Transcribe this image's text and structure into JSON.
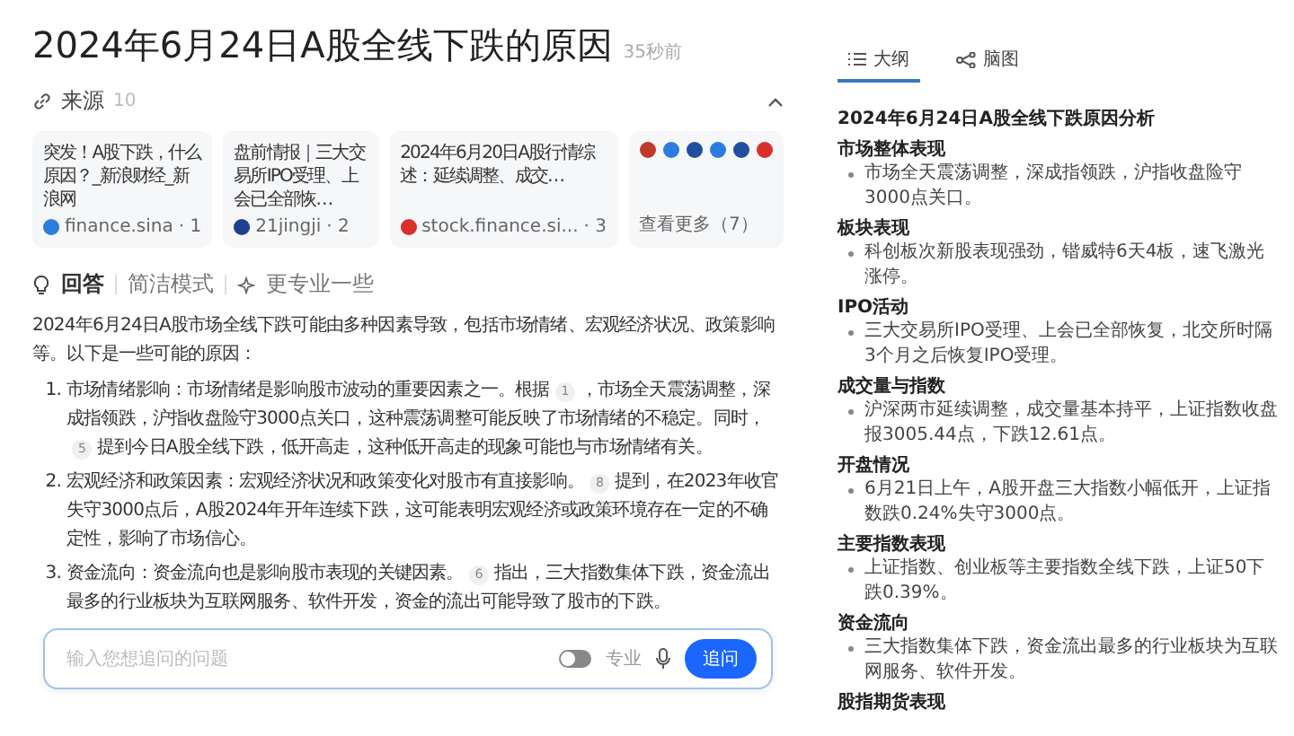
{
  "title": "2024年6月24日A股全线下跌的原因",
  "time": "35秒前",
  "sources": {
    "label": "来源",
    "count": "10",
    "expanded": true,
    "cards": [
      {
        "title": "突发！A股下跌，什么原因？_新浪财经_新浪网",
        "site": "finance.sina",
        "index": "· 1",
        "color": "#2b7de0"
      },
      {
        "title": "盘前情报｜三大交易所IPO受理、上会已全部恢…",
        "site": "21jingji",
        "index": "· 2",
        "color": "#1f3f8f"
      },
      {
        "title": "2024年6月20日A股行情综述：延续调整、成交…",
        "site": "stock.finance.si...",
        "index": "· 3",
        "color": "#d9302b"
      }
    ],
    "more": {
      "label": "查看更多（7）",
      "icons": [
        {
          "color": "#c0392b"
        },
        {
          "color": "#2b7de0"
        },
        {
          "color": "#1f4f9f"
        },
        {
          "color": "#2b7de0"
        },
        {
          "color": "#1f4f9f"
        },
        {
          "color": "#d9302b"
        }
      ]
    }
  },
  "modes": [
    {
      "label": "回答",
      "kind": "answer",
      "selected": true
    },
    {
      "label": "简洁模式",
      "kind": "plain",
      "selected": false
    },
    {
      "label": "更专业一些",
      "kind": "spark",
      "selected": false
    }
  ],
  "intro": "2024年6月24日A股市场全线下跌可能由多种因素导致，包括市场情绪、宏观经济状况、政策影响等。以下是一些可能的原因：",
  "points": [
    {
      "number": "1.",
      "segments": [
        {
          "kind": "text",
          "text": "市场情绪影响：市场情绪是影响股市波动的重要因素之一。根据"
        },
        {
          "kind": "cite",
          "text": "1"
        },
        {
          "kind": "text",
          "text": "，市场全天震荡调整，深成指领跌，沪指收盘险守3000点关口，这种震荡调整可能反映了市场情绪的不稳定。同时，"
        },
        {
          "kind": "cite",
          "text": "5"
        },
        {
          "kind": "text",
          "text": "提到今日A股全线下跌，低开高走，这种低开高走的现象可能也与市场情绪有关。"
        }
      ]
    },
    {
      "number": "2.",
      "segments": [
        {
          "kind": "text",
          "text": "宏观经济和政策因素：宏观经济状况和政策变化对股市有直接影响。"
        },
        {
          "kind": "cite",
          "text": "8"
        },
        {
          "kind": "text",
          "text": "提到，在2023年收官失守3000点后，A股2024年开年连续下跌，这可能表明宏观经济或政策环境存在一定的不确定性，影响了市场信心。"
        }
      ]
    },
    {
      "number": "3.",
      "segments": [
        {
          "kind": "text",
          "text": "资金流向：资金流向也是影响股市表现的关键因素。"
        },
        {
          "kind": "cite",
          "text": "6"
        },
        {
          "kind": "text",
          "text": "指出，三大指数集体下跌，资金流出最多的行业板块为互联网服务、软件开发，资金的流出可能导致了股市的下跌。"
        }
      ]
    }
  ],
  "ask": {
    "placeholder": "输入您想追问的问题",
    "toggle_label": "专业",
    "toggle_on": false,
    "button": "追问"
  },
  "panel_tabs": [
    {
      "label": "大纲",
      "kind": "list",
      "selected": true
    },
    {
      "label": "脑图",
      "kind": "mindmap",
      "selected": false
    }
  ],
  "outline": {
    "title": "2024年6月24日A股全线下跌原因分析",
    "sections": [
      {
        "heading": "市场整体表现",
        "bullets": [
          "市场全天震荡调整，深成指领跌，沪指收盘险守3000点关口。"
        ]
      },
      {
        "heading": "板块表现",
        "bullets": [
          "科创板次新股表现强劲，锴威特6天4板，速飞激光涨停。"
        ]
      },
      {
        "heading": "IPO活动",
        "bullets": [
          "三大交易所IPO受理、上会已全部恢复，北交所时隔3个月之后恢复IPO受理。"
        ]
      },
      {
        "heading": "成交量与指数",
        "bullets": [
          "沪深两市延续调整，成交量基本持平，上证指数收盘报3005.44点，下跌12.61点。"
        ]
      },
      {
        "heading": "开盘情况",
        "bullets": [
          "6月21日上午，A股开盘三大指数小幅低开，上证指数跌0.24%失守3000点。"
        ]
      },
      {
        "heading": "主要指数表现",
        "bullets": [
          "上证指数、创业板等主要指数全线下跌，上证50下跌0.39%。"
        ]
      },
      {
        "heading": "资金流向",
        "bullets": [
          "三大指数集体下跌，资金流出最多的行业板块为互联网服务、软件开发。"
        ]
      },
      {
        "heading": "股指期货表现"
      }
    ]
  }
}
